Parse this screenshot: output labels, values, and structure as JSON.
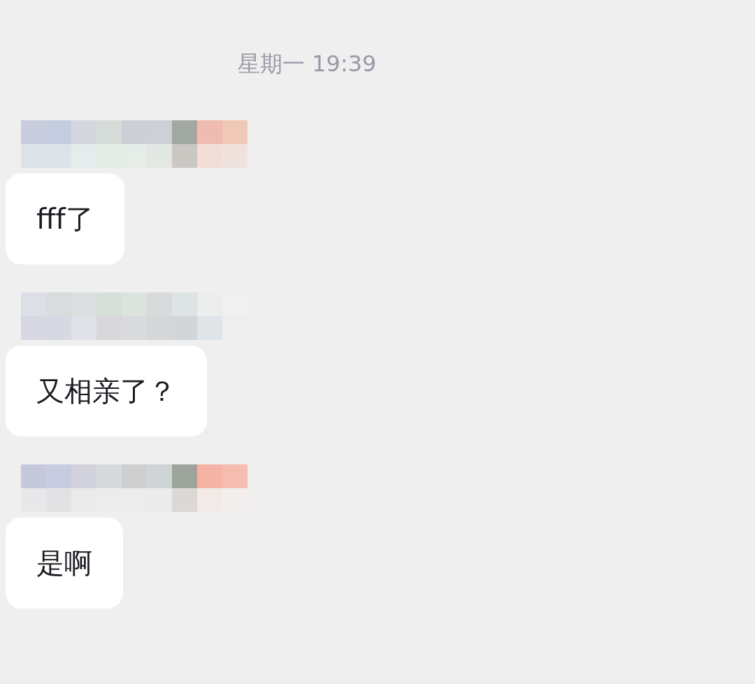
{
  "timestamp": "星期一 19:39",
  "messages": [
    {
      "text": "fff了"
    },
    {
      "text": "又相亲了？"
    },
    {
      "text": "是啊"
    }
  ]
}
